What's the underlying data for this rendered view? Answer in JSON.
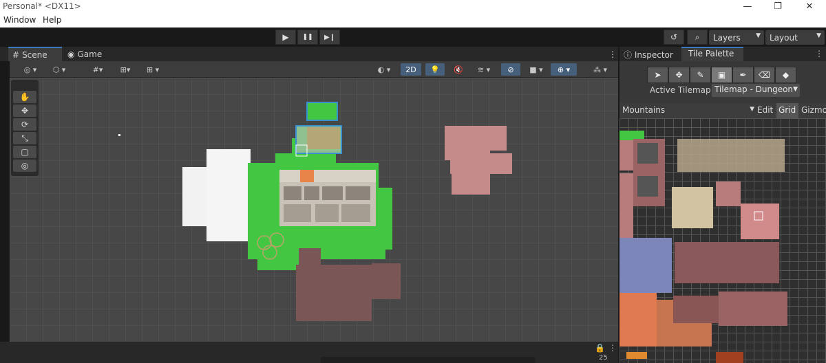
{
  "window": {
    "title": "Personal* <DX11>"
  },
  "menu": [
    "Window",
    "Help"
  ],
  "toolbar": {
    "play": "▶",
    "pause": "❚❚",
    "step": "▶❙",
    "layers_label": "Layers",
    "layout_label": "Layout"
  },
  "scene_tabs": [
    "Scene",
    "Game"
  ],
  "scene_toolbar": {
    "mode_2d": "2D"
  },
  "tools": [
    "✋",
    "✥",
    "⟳",
    "⤡",
    "▢",
    "◎"
  ],
  "right_tabs": [
    "Inspector",
    "Tile Palette"
  ],
  "palette": {
    "active_tilemap_label": "Active Tilemap",
    "active_tilemap_value": "Tilemap - Dungeon",
    "palette_name": "Mountains",
    "edit_label": "Edit",
    "grid_label": "Grid",
    "gizmos_label": "Gizmos"
  },
  "status": {
    "count": "25"
  },
  "colors": {
    "accent": "#3a79bb",
    "grass": "#43c743",
    "pink": "#c58a8a",
    "brown": "#7b5656"
  }
}
